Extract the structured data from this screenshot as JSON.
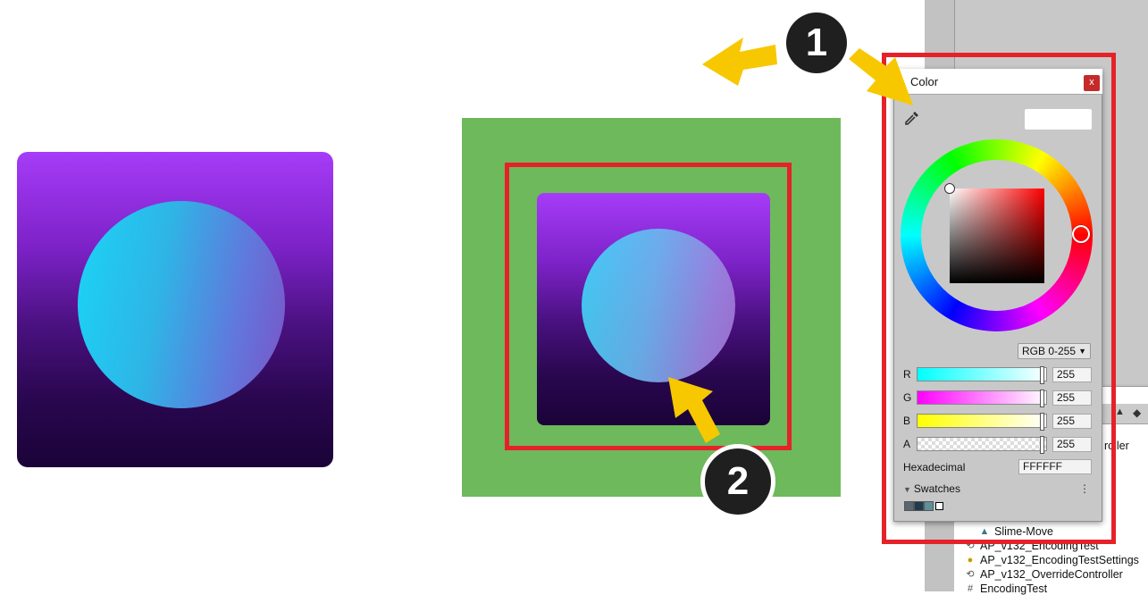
{
  "markers": {
    "one": "1",
    "two": "2"
  },
  "color_picker": {
    "title": "Color",
    "close": "x",
    "mode": "RGB 0-255",
    "channels": [
      {
        "label": "R",
        "value": "255"
      },
      {
        "label": "G",
        "value": "255"
      },
      {
        "label": "B",
        "value": "255"
      },
      {
        "label": "A",
        "value": "255"
      }
    ],
    "hex_label": "Hexadecimal",
    "hex_value": "FFFFFF",
    "swatches_label": "Swatches",
    "swatches_menu": "⋮",
    "swatch_colors": [
      "#5a6670",
      "#1f3b4d",
      "#5f8f99",
      "#ffffff"
    ]
  },
  "project": {
    "items": [
      {
        "label": "Slime-Move",
        "icon": "animation-icon"
      },
      {
        "label": "AP_v132_EncodingTest",
        "icon": "controller-icon"
      },
      {
        "label": "AP_v132_EncodingTestSettings",
        "icon": "settings-icon"
      },
      {
        "label": "AP_v132_OverrideController",
        "icon": "override-controller-icon"
      },
      {
        "label": "EncodingTest",
        "icon": "script-icon"
      }
    ],
    "partial_label": "roller"
  },
  "colors": {
    "highlight": "#e52229",
    "arrow": "#f7c800",
    "green_panel": "#6eb95b",
    "icon_top": "#a63cf8",
    "icon_bottom": "#1a0338"
  }
}
